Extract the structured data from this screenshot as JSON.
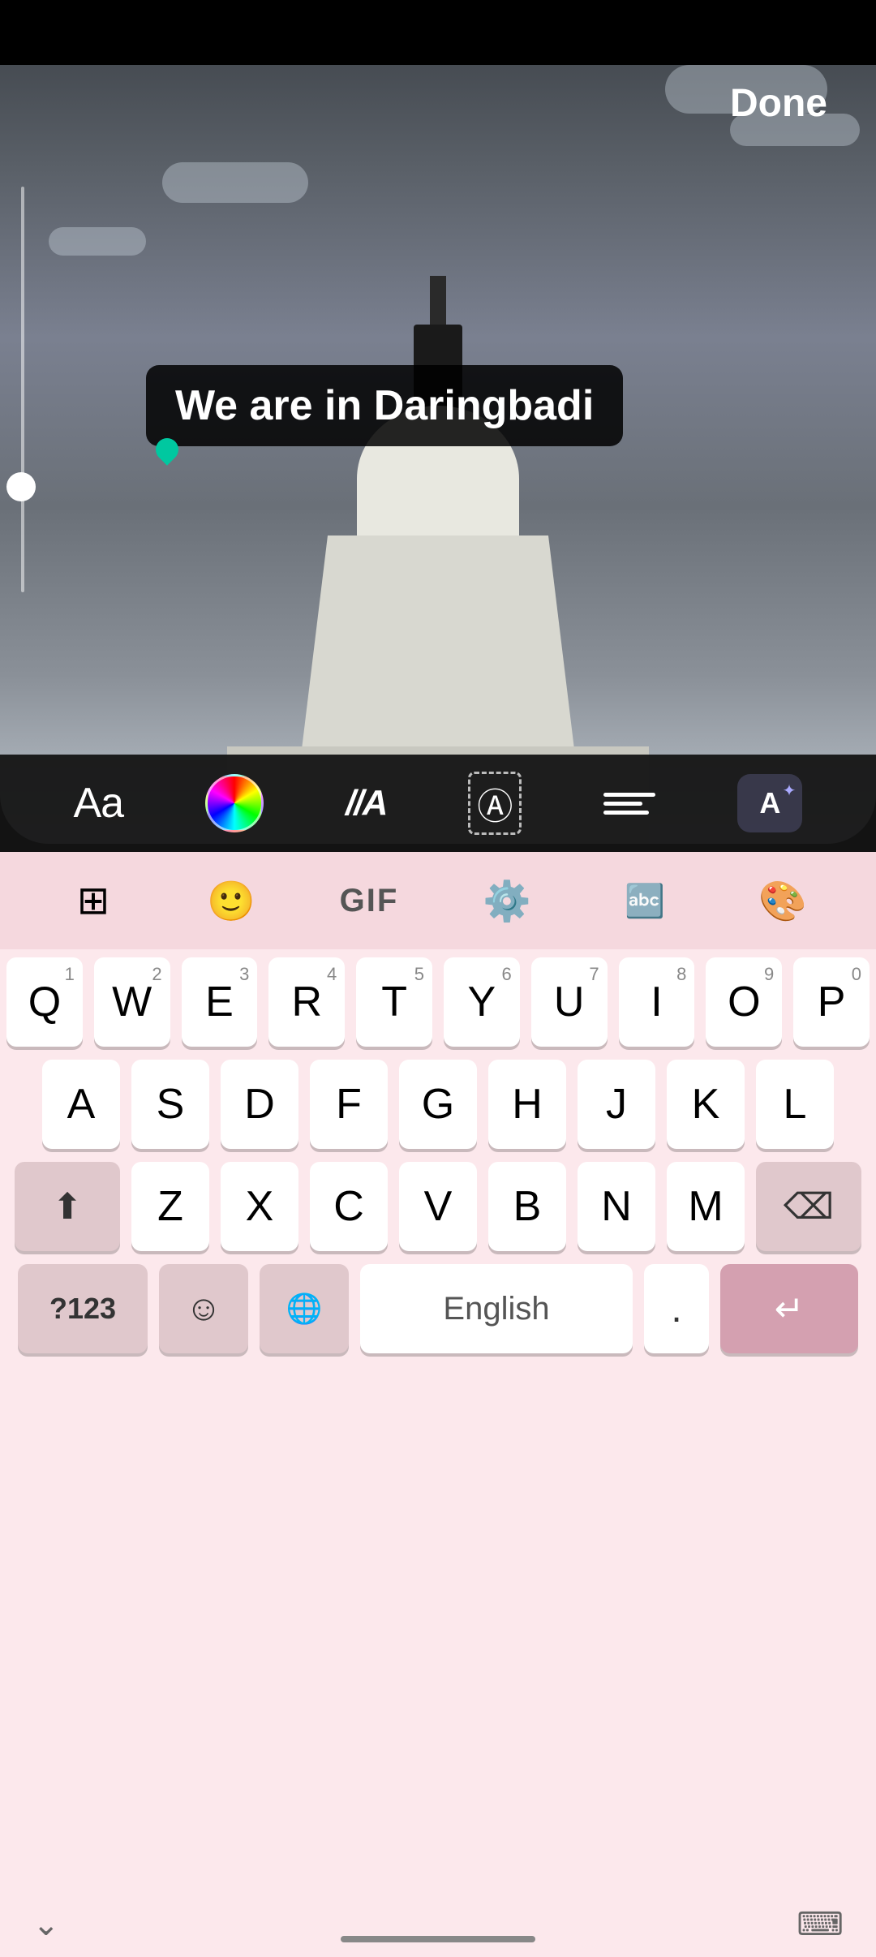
{
  "topBar": {
    "background": "#000000"
  },
  "header": {
    "done_label": "Done"
  },
  "photo": {
    "text_overlay": "We are in Daringbadi",
    "color_accent": "#00c8a0"
  },
  "toolbar": {
    "aa_label": "Aa",
    "font_style_label": "//A",
    "text_bg_label": "A",
    "align_label": "align",
    "ai_label": "A+"
  },
  "keyboard": {
    "topbar": {
      "apps_icon": "⊞",
      "sticker_icon": "😊",
      "gif_label": "GIF",
      "settings_icon": "⚙",
      "translate_icon": "G►",
      "palette_icon": "🎨"
    },
    "rows": [
      {
        "keys": [
          {
            "label": "Q",
            "num": "1"
          },
          {
            "label": "W",
            "num": "2"
          },
          {
            "label": "E",
            "num": "3"
          },
          {
            "label": "R",
            "num": "4"
          },
          {
            "label": "T",
            "num": "5"
          },
          {
            "label": "Y",
            "num": "6"
          },
          {
            "label": "U",
            "num": "7"
          },
          {
            "label": "I",
            "num": "8"
          },
          {
            "label": "O",
            "num": "9"
          },
          {
            "label": "P",
            "num": "0"
          }
        ]
      },
      {
        "keys": [
          {
            "label": "A"
          },
          {
            "label": "S"
          },
          {
            "label": "D"
          },
          {
            "label": "F"
          },
          {
            "label": "G"
          },
          {
            "label": "H"
          },
          {
            "label": "J"
          },
          {
            "label": "K"
          },
          {
            "label": "L"
          }
        ]
      },
      {
        "keys": [
          {
            "label": "Z"
          },
          {
            "label": "X"
          },
          {
            "label": "C"
          },
          {
            "label": "V"
          },
          {
            "label": "B"
          },
          {
            "label": "N"
          },
          {
            "label": "M"
          }
        ]
      }
    ],
    "bottomRow": {
      "nums_label": "?123",
      "emoji_label": "☺",
      "lang_label": "🌐",
      "space_label": "English",
      "period_label": ".",
      "return_label": "↵"
    }
  }
}
